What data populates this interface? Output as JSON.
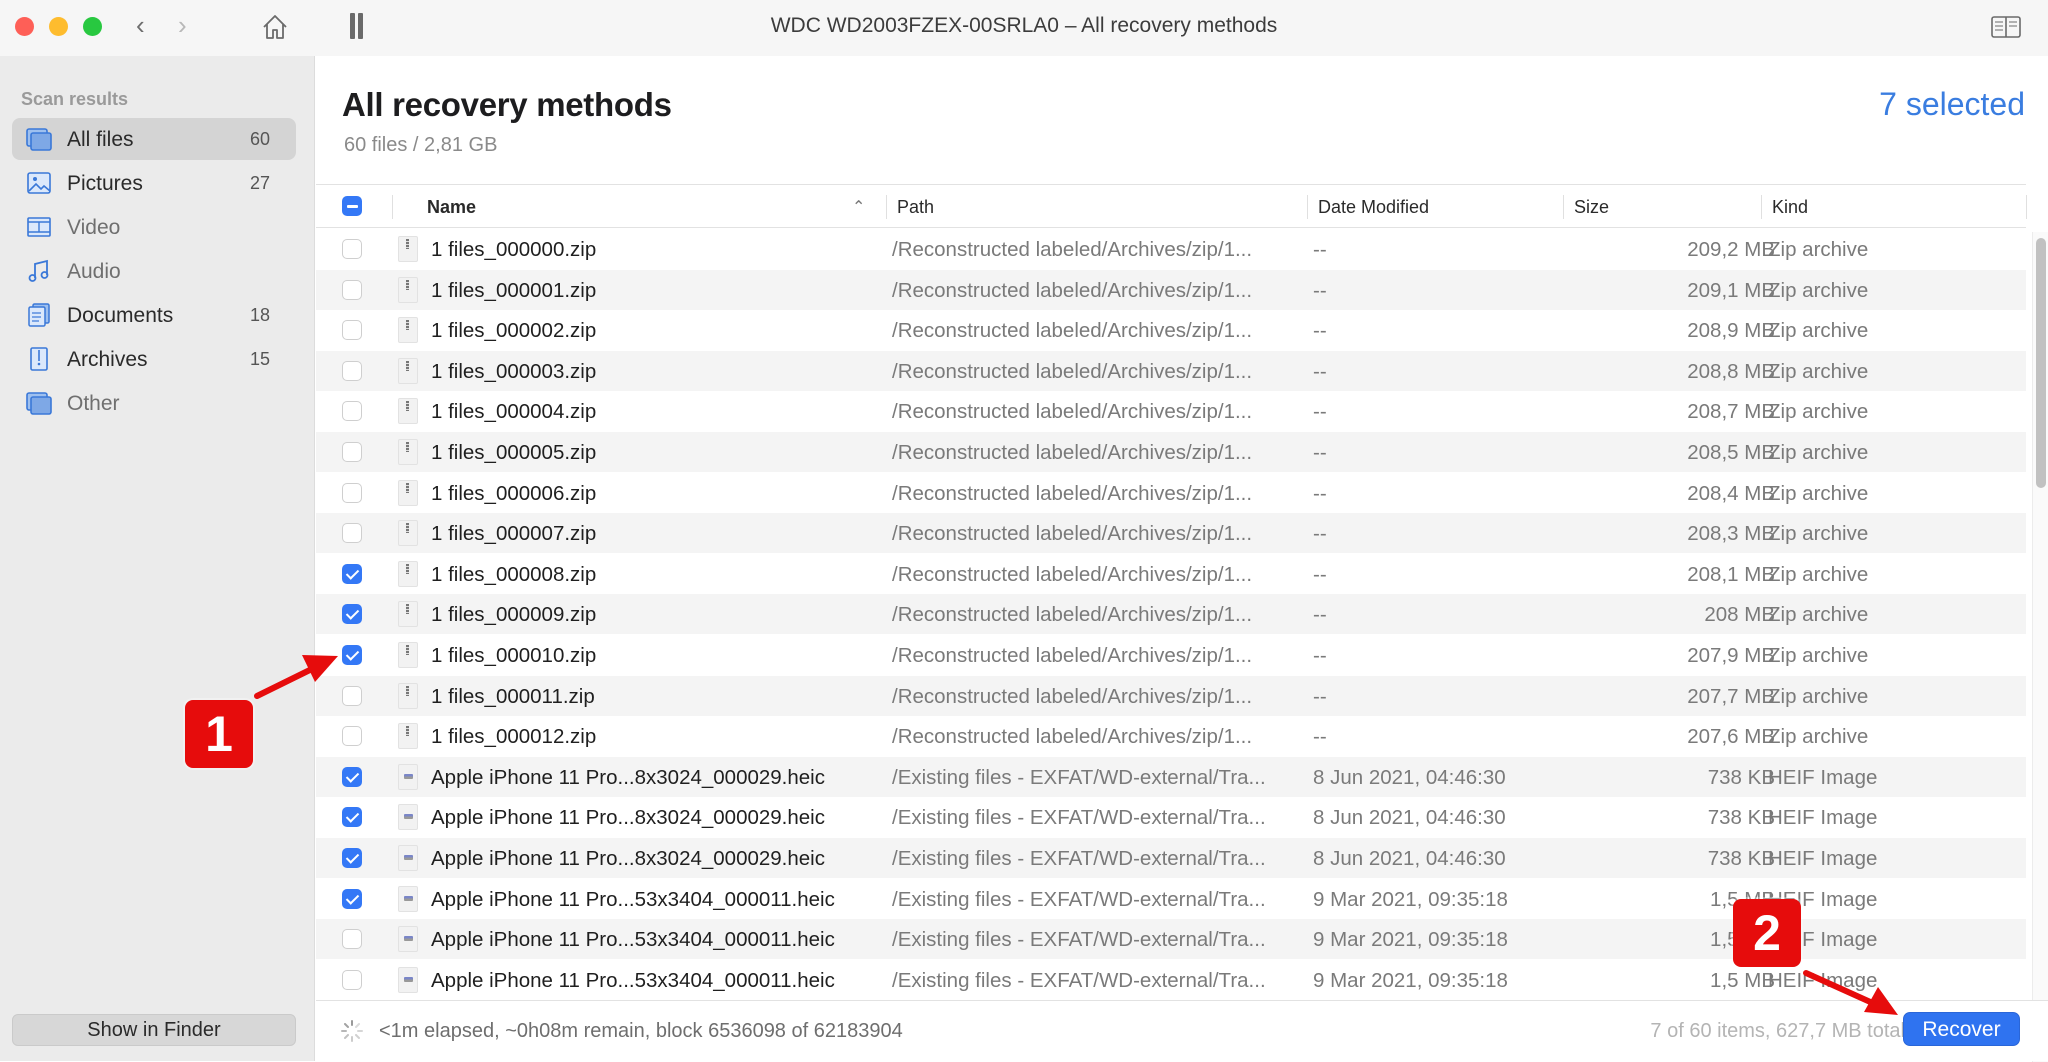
{
  "window": {
    "title": "WDC WD2003FZEX-00SRLA0 – All recovery methods",
    "scan_progress": 0.102
  },
  "toolbar": {
    "back_icon": "chevron-left-icon",
    "forward_icon": "chevron-right-icon",
    "home_icon": "home-icon",
    "pause_icon": "pause-icon",
    "reader_icon": "book-icon"
  },
  "sidebar": {
    "section_label": "Scan results",
    "items": [
      {
        "label": "All files",
        "count": "60",
        "icon": "all-files-icon",
        "selected": true
      },
      {
        "label": "Pictures",
        "count": "27",
        "icon": "pictures-icon",
        "selected": false
      },
      {
        "label": "Video",
        "count": "",
        "icon": "video-icon",
        "selected": false
      },
      {
        "label": "Audio",
        "count": "",
        "icon": "audio-icon",
        "selected": false
      },
      {
        "label": "Documents",
        "count": "18",
        "icon": "documents-icon",
        "selected": false
      },
      {
        "label": "Archives",
        "count": "15",
        "icon": "archives-icon",
        "selected": false
      },
      {
        "label": "Other",
        "count": "",
        "icon": "other-icon",
        "selected": false
      }
    ],
    "show_in_finder_label": "Show in Finder"
  },
  "main": {
    "title": "All recovery methods",
    "subtitle": "60 files / 2,81 GB",
    "selected_count": "7 selected",
    "accent_color": "#3a7de0"
  },
  "table": {
    "columns": {
      "name": "Name",
      "path": "Path",
      "date": "Date Modified",
      "size": "Size",
      "kind": "Kind"
    },
    "header_checkbox_state": "mixed",
    "sort_column": "Name",
    "sort_direction": "ascending",
    "rows": [
      {
        "checked": false,
        "type": "zip",
        "name": "1 files_000000.zip",
        "path": "/Reconstructed labeled/Archives/zip/1...",
        "date": "--",
        "size": "209,2 MB",
        "kind": "Zip archive"
      },
      {
        "checked": false,
        "type": "zip",
        "name": "1 files_000001.zip",
        "path": "/Reconstructed labeled/Archives/zip/1...",
        "date": "--",
        "size": "209,1 MB",
        "kind": "Zip archive"
      },
      {
        "checked": false,
        "type": "zip",
        "name": "1 files_000002.zip",
        "path": "/Reconstructed labeled/Archives/zip/1...",
        "date": "--",
        "size": "208,9 MB",
        "kind": "Zip archive"
      },
      {
        "checked": false,
        "type": "zip",
        "name": "1 files_000003.zip",
        "path": "/Reconstructed labeled/Archives/zip/1...",
        "date": "--",
        "size": "208,8 MB",
        "kind": "Zip archive"
      },
      {
        "checked": false,
        "type": "zip",
        "name": "1 files_000004.zip",
        "path": "/Reconstructed labeled/Archives/zip/1...",
        "date": "--",
        "size": "208,7 MB",
        "kind": "Zip archive"
      },
      {
        "checked": false,
        "type": "zip",
        "name": "1 files_000005.zip",
        "path": "/Reconstructed labeled/Archives/zip/1...",
        "date": "--",
        "size": "208,5 MB",
        "kind": "Zip archive"
      },
      {
        "checked": false,
        "type": "zip",
        "name": "1 files_000006.zip",
        "path": "/Reconstructed labeled/Archives/zip/1...",
        "date": "--",
        "size": "208,4 MB",
        "kind": "Zip archive"
      },
      {
        "checked": false,
        "type": "zip",
        "name": "1 files_000007.zip",
        "path": "/Reconstructed labeled/Archives/zip/1...",
        "date": "--",
        "size": "208,3 MB",
        "kind": "Zip archive"
      },
      {
        "checked": true,
        "type": "zip",
        "name": "1 files_000008.zip",
        "path": "/Reconstructed labeled/Archives/zip/1...",
        "date": "--",
        "size": "208,1 MB",
        "kind": "Zip archive"
      },
      {
        "checked": true,
        "type": "zip",
        "name": "1 files_000009.zip",
        "path": "/Reconstructed labeled/Archives/zip/1...",
        "date": "--",
        "size": "208 MB",
        "kind": "Zip archive"
      },
      {
        "checked": true,
        "type": "zip",
        "name": "1 files_000010.zip",
        "path": "/Reconstructed labeled/Archives/zip/1...",
        "date": "--",
        "size": "207,9 MB",
        "kind": "Zip archive"
      },
      {
        "checked": false,
        "type": "zip",
        "name": "1 files_000011.zip",
        "path": "/Reconstructed labeled/Archives/zip/1...",
        "date": "--",
        "size": "207,7 MB",
        "kind": "Zip archive"
      },
      {
        "checked": false,
        "type": "zip",
        "name": "1 files_000012.zip",
        "path": "/Reconstructed labeled/Archives/zip/1...",
        "date": "--",
        "size": "207,6 MB",
        "kind": "Zip archive"
      },
      {
        "checked": true,
        "type": "heic",
        "name": "Apple iPhone 11 Pro...8x3024_000029.heic",
        "path": "/Existing files - EXFAT/WD-external/Tra...",
        "date": "8 Jun 2021, 04:46:30",
        "size": "738 KB",
        "kind": "HEIF Image"
      },
      {
        "checked": true,
        "type": "heic",
        "name": "Apple iPhone 11 Pro...8x3024_000029.heic",
        "path": "/Existing files - EXFAT/WD-external/Tra...",
        "date": "8 Jun 2021, 04:46:30",
        "size": "738 KB",
        "kind": "HEIF Image"
      },
      {
        "checked": true,
        "type": "heic",
        "name": "Apple iPhone 11 Pro...8x3024_000029.heic",
        "path": "/Existing files - EXFAT/WD-external/Tra...",
        "date": "8 Jun 2021, 04:46:30",
        "size": "738 KB",
        "kind": "HEIF Image"
      },
      {
        "checked": true,
        "type": "heic",
        "name": "Apple iPhone 11 Pro...53x3404_000011.heic",
        "path": "/Existing files - EXFAT/WD-external/Tra...",
        "date": "9 Mar 2021, 09:35:18",
        "size": "1,5 MB",
        "kind": "HEIF Image"
      },
      {
        "checked": false,
        "type": "heic",
        "name": "Apple iPhone 11 Pro...53x3404_000011.heic",
        "path": "/Existing files - EXFAT/WD-external/Tra...",
        "date": "9 Mar 2021, 09:35:18",
        "size": "1,5 MB",
        "kind": "HEIF Image"
      },
      {
        "checked": false,
        "type": "heic",
        "name": "Apple iPhone 11 Pro...53x3404_000011.heic",
        "path": "/Existing files - EXFAT/WD-external/Tra...",
        "date": "9 Mar 2021, 09:35:18",
        "size": "1,5 MB",
        "kind": "HEIF Image"
      }
    ]
  },
  "footer": {
    "status": "<1m elapsed, ~0h08m remain, block 6536098 of 62183904",
    "summary": "7 of 60 items, 627,7 MB total",
    "recover_label": "Recover"
  },
  "annotations": {
    "callout_1": "1",
    "callout_2": "2",
    "callout_color": "#e60c0c"
  }
}
